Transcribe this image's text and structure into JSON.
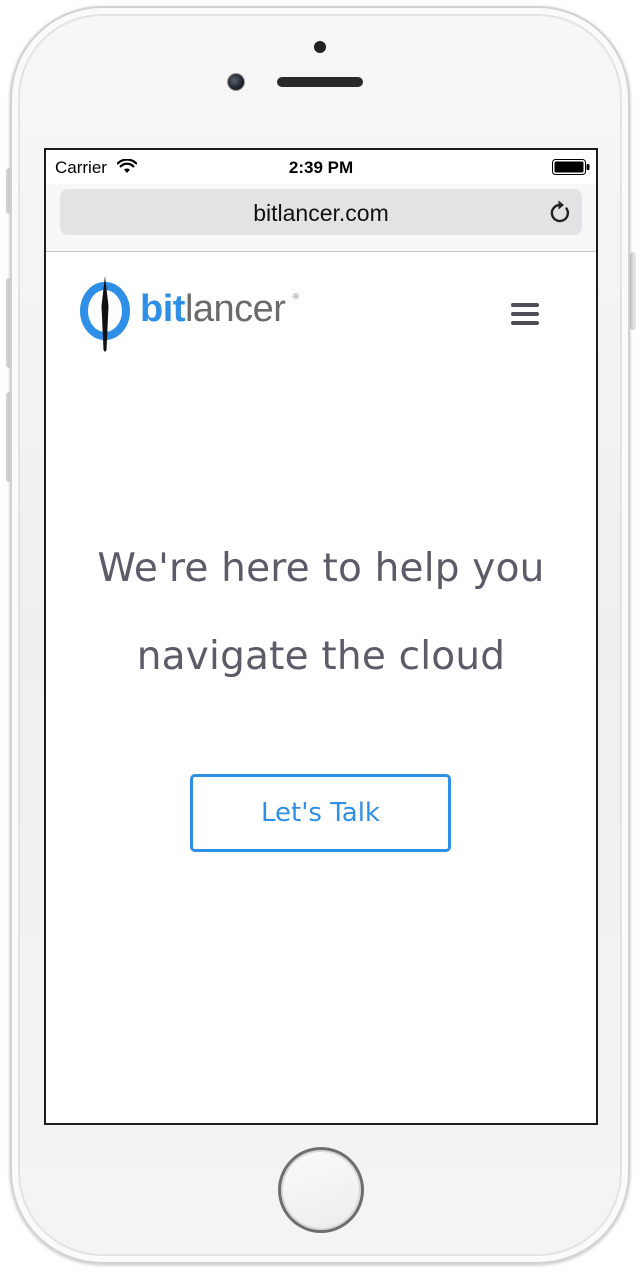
{
  "status_bar": {
    "carrier": "Carrier",
    "time": "2:39 PM",
    "wifi_icon": "wifi-icon",
    "battery_icon": "battery-full-icon"
  },
  "browser": {
    "url": "bitlancer.com",
    "reload_icon": "reload-icon"
  },
  "site": {
    "logo": {
      "brand_part1": "bit",
      "brand_part2": "lancer",
      "registered_mark": "®"
    },
    "menu_icon": "hamburger-menu-icon",
    "hero_line1": "We're here to help you",
    "hero_line2": "navigate the cloud",
    "cta_label": "Let's Talk"
  },
  "colors": {
    "brand_blue": "#2e8fe6",
    "brand_gray": "#6b6b6b",
    "hero_text": "#5c5c68",
    "menu_icon": "#4e4e57"
  }
}
